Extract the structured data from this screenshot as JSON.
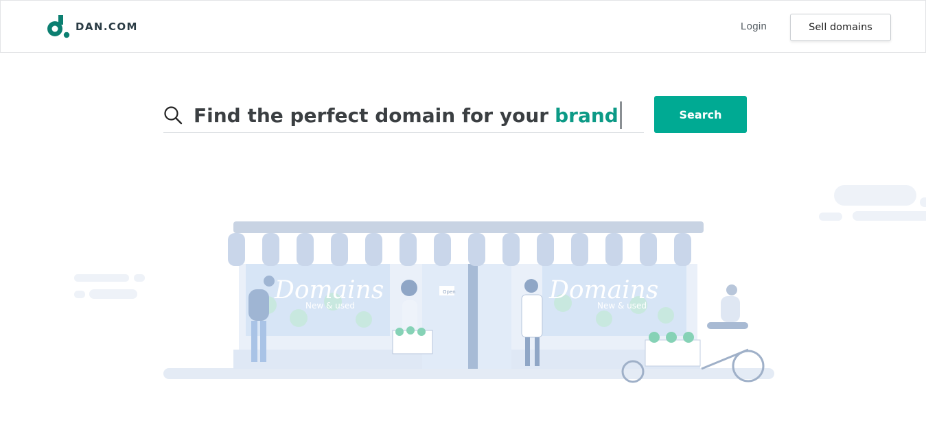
{
  "header": {
    "brand": "DAN.COM",
    "login_label": "Login",
    "sell_label": "Sell domains"
  },
  "search": {
    "prompt": "Find the perfect domain for your",
    "highlight": "brand",
    "button_label": "Search"
  },
  "illustration": {
    "window_sign": "Domains",
    "window_sign_sub": "New & used",
    "door_sign": "Open"
  },
  "colors": {
    "brand_green": "#00aa93",
    "highlight_text": "#0c9a86",
    "illustration_blue": "#c9d6ea"
  },
  "icons": [
    "dan-logo-icon",
    "search-icon"
  ]
}
